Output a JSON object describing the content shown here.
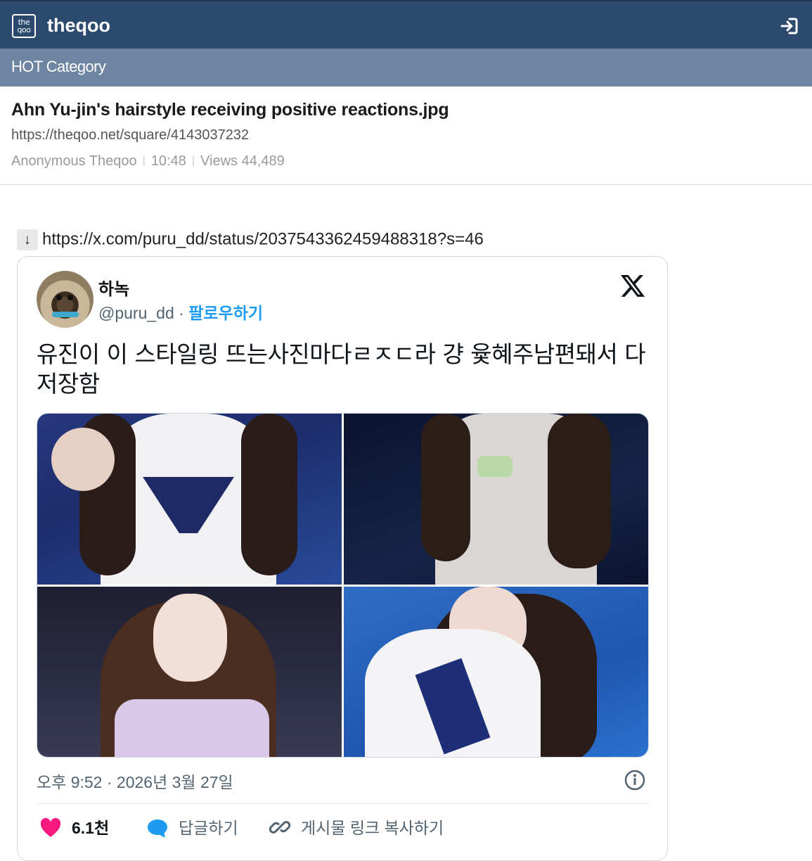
{
  "header": {
    "logo_text": "the\nqoo",
    "brand": "theqoo",
    "login_icon": "login-icon"
  },
  "category": {
    "label": "HOT Category"
  },
  "post": {
    "title": "Ahn Yu-jin's hairstyle receiving positive reactions.jpg",
    "url": "https://theqoo.net/square/4143037232",
    "author": "Anonymous Theqoo",
    "time": "10:48",
    "views_label": "Views 44,489"
  },
  "source": {
    "arrow": "↓",
    "link": "https://x.com/puru_dd/status/2037543362459488318?s=46"
  },
  "tweet": {
    "display_name": "하녹",
    "handle": "@puru_dd",
    "separator": " · ",
    "follow_label": "팔로우하기",
    "text": "유진이 이 스타일링 뜨는사진마다ㄹㅈㄷ라 걍 윷혜주남편돼서 다 저장함",
    "timestamp": "오후 9:52 · 2026년 3월 27일",
    "like_count": "6.1천",
    "reply_label": "답글하기",
    "copy_link_label": "게시물 링크 복사하기",
    "colors": {
      "link_blue": "#1d9bf0",
      "like_pink": "#f91880",
      "reply_blue": "#1d9bf0"
    }
  }
}
